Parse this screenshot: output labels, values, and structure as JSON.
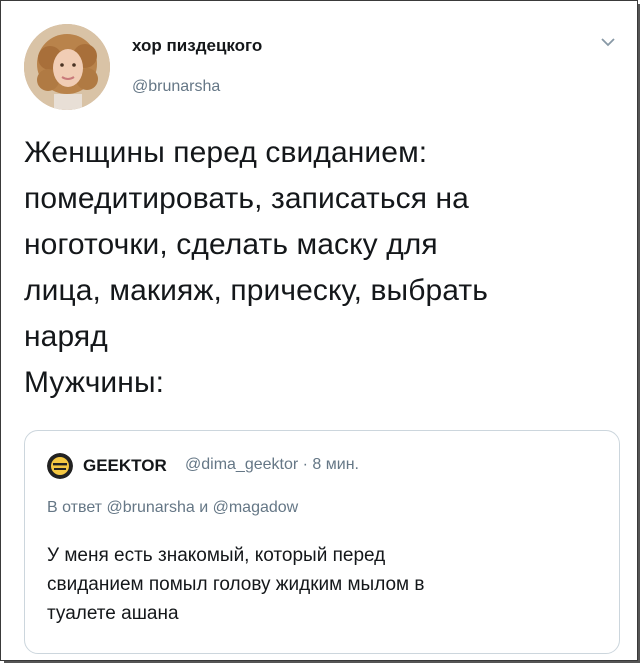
{
  "tweet": {
    "display_name": "хор пиздецкого",
    "handle": "@brunarsha",
    "text": "Женщины перед свиданием:\nпомедитировать, записаться на\nноготочки, сделать маску для\nлица, макияж, прическу, выбрать\nнаряд\nМужчины:"
  },
  "quoted": {
    "display_name": "GEEKTOR",
    "meta": "@dima_geektor · 8 мин.",
    "reply_prefix": "В ответ",
    "reply_user1": "@brunarsha",
    "reply_joiner": "и",
    "reply_user2": "@magadow",
    "text": "У меня есть знакомый, который перед\nсвиданием помыл голову жидким мылом в\nтуалете ашана"
  },
  "icons": {
    "avatar": "user-avatar-photo",
    "menu": "chevron-down-icon",
    "quoted_avatar": "emoji-avatar-icon"
  }
}
